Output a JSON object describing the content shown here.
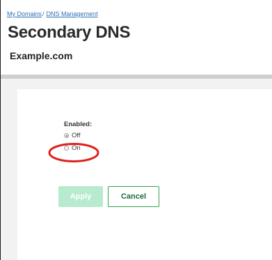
{
  "breadcrumb": {
    "items": [
      {
        "label": "My Domains"
      },
      {
        "label": "DNS Management"
      }
    ],
    "separator": "/"
  },
  "header": {
    "title": "Secondary DNS",
    "domain": "Example.com"
  },
  "form": {
    "enabled_label": "Enabled:",
    "options": [
      {
        "label": "Off",
        "checked": true
      },
      {
        "label": "On",
        "checked": false
      }
    ],
    "apply_label": "Apply",
    "cancel_label": "Cancel",
    "apply_disabled": true
  },
  "annotation": {
    "ellipse_color": "#e0201c",
    "target": "On"
  },
  "colors": {
    "link": "#2e6eb8",
    "apply_disabled_bg": "#b8ead0",
    "cancel_border": "#2ea44f",
    "divider": "#cfcfcf",
    "content_bg": "#f2f2f2"
  }
}
